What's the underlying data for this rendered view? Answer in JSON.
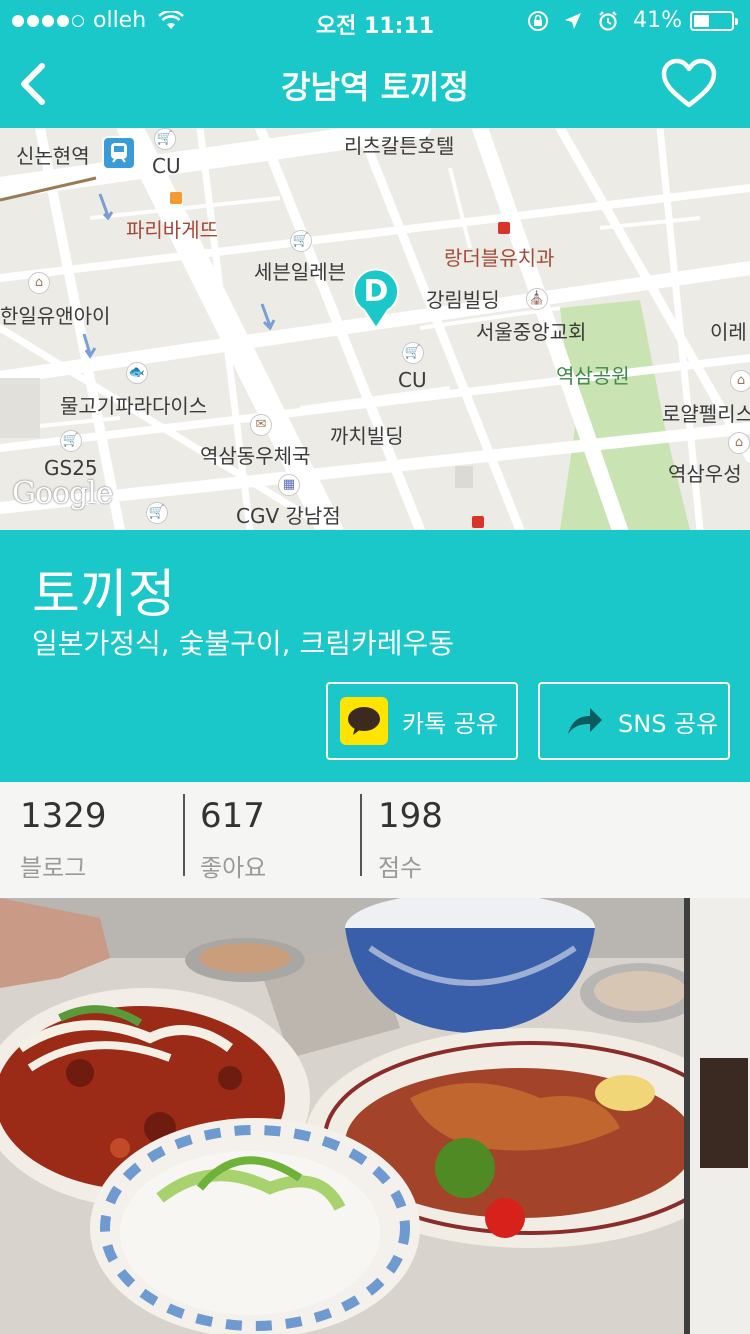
{
  "status_bar": {
    "carrier": "olleh",
    "time": "오전 11:11",
    "battery": "41%",
    "battery_level": 0.41,
    "signal_bars_filled": 4,
    "signal_bars_total": 5
  },
  "nav": {
    "title": "강남역 토끼정",
    "icons": [
      "back-chevron-icon",
      "heart-icon"
    ]
  },
  "map": {
    "labels": {
      "sinnonhyeon": "신논현역",
      "cu1": "CU",
      "ritz": "리츠칼튼호텔",
      "paris": "파리바게뜨",
      "seven": "세븐일레븐",
      "rangdeo": "랑더블유치과",
      "hanil": "한일유앤아이",
      "kanglim": "강림빌딩",
      "seoulchurch": "서울중앙교회",
      "ire": "이레",
      "cu2": "CU",
      "yeoksam_park": "역삼공원",
      "fish": "물고기파라다이스",
      "royal": "로얄펠리스",
      "kkachi": "까치빌딩",
      "gs25": "GS25",
      "post": "역삼동우체국",
      "yeoksam_u": "역삼우성",
      "cgv": "CGV 강남점"
    },
    "attribution": "Google",
    "marker_letter": "D"
  },
  "restaurant": {
    "name": "토끼정",
    "categories": "일본가정식, 숯불구이, 크림카레우동"
  },
  "share": {
    "kakao_label": "카톡 공유",
    "sns_label": "SNS 공유"
  },
  "stats": [
    {
      "value": "1329",
      "label": "블로그"
    },
    {
      "value": "617",
      "label": "좋아요"
    },
    {
      "value": "198",
      "label": "점수"
    }
  ],
  "colors": {
    "accent": "#1ac7c9",
    "map_bg": "#ecebe6",
    "stats_bg": "#f5f5f3"
  }
}
